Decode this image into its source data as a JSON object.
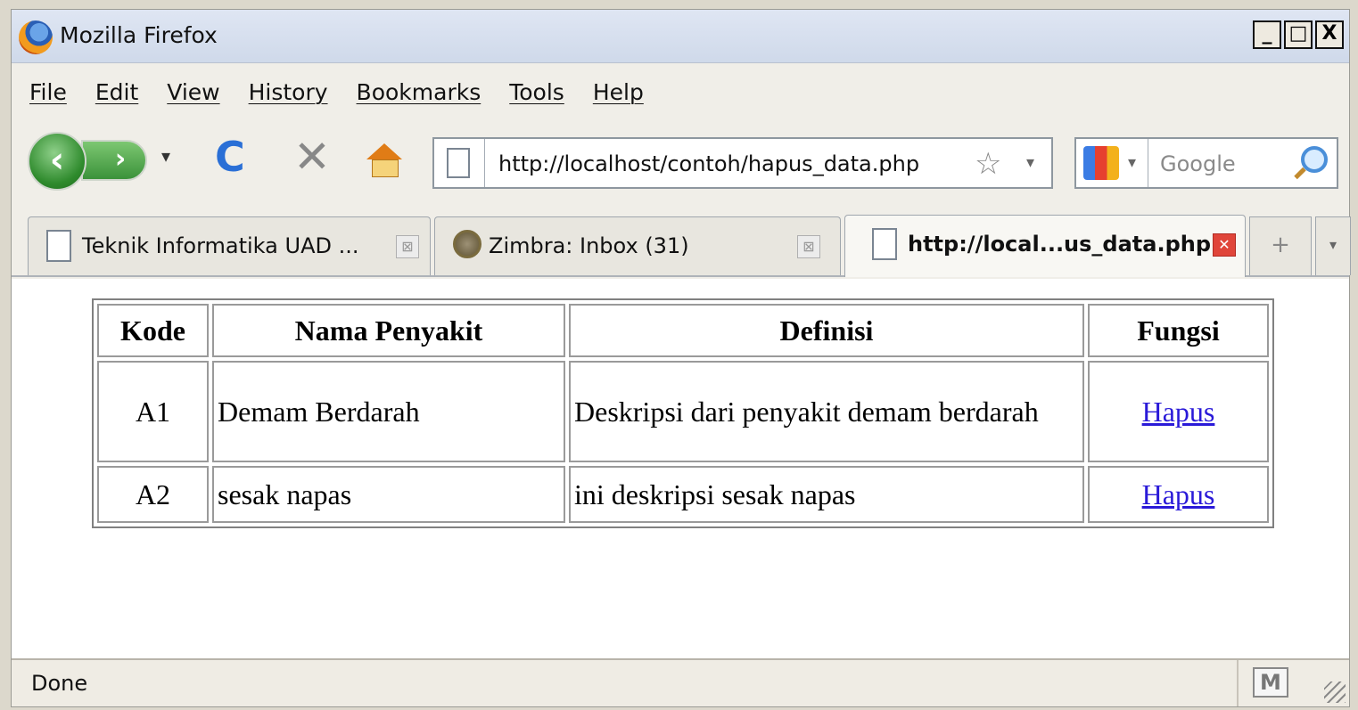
{
  "window": {
    "title": "Mozilla Firefox",
    "minimize": "_",
    "maximize": "□",
    "close": "X"
  },
  "menu": [
    "File",
    "Edit",
    "View",
    "History",
    "Bookmarks",
    "Tools",
    "Help"
  ],
  "navbar": {
    "back": "‹",
    "forward": "›",
    "history_dropdown": "▾",
    "reload": "C",
    "stop": "✕",
    "url": "http://localhost/contoh/hapus_data.php",
    "bookmark_star": "☆",
    "url_dropdown": "▾",
    "search_engine_dropdown": "▾",
    "search_placeholder": "Google"
  },
  "tabs": [
    {
      "label": "Teknik Informatika UAD ...",
      "close": "⊠"
    },
    {
      "label": "Zimbra: Inbox (31)",
      "close": "⊠"
    },
    {
      "label": "http://local...us_data.php",
      "close": "✕"
    }
  ],
  "newtab": "+",
  "alltabs": "▾",
  "table": {
    "headers": [
      "Kode",
      "Nama Penyakit",
      "Definisi",
      "Fungsi"
    ],
    "rows": [
      {
        "kode": "A1",
        "nama": "Demam Berdarah",
        "definisi": "Deskripsi dari penyakit demam berdarah",
        "fungsi": "Hapus"
      },
      {
        "kode": "A2",
        "nama": "sesak napas",
        "definisi": "ini deskripsi sesak napas",
        "fungsi": "Hapus"
      }
    ]
  },
  "status": {
    "text": "Done",
    "gmail": "M"
  },
  "colors": {
    "link": "#2a1ad8",
    "active_tab_close": "#e0453a",
    "back_button": "#2e8a2c"
  }
}
